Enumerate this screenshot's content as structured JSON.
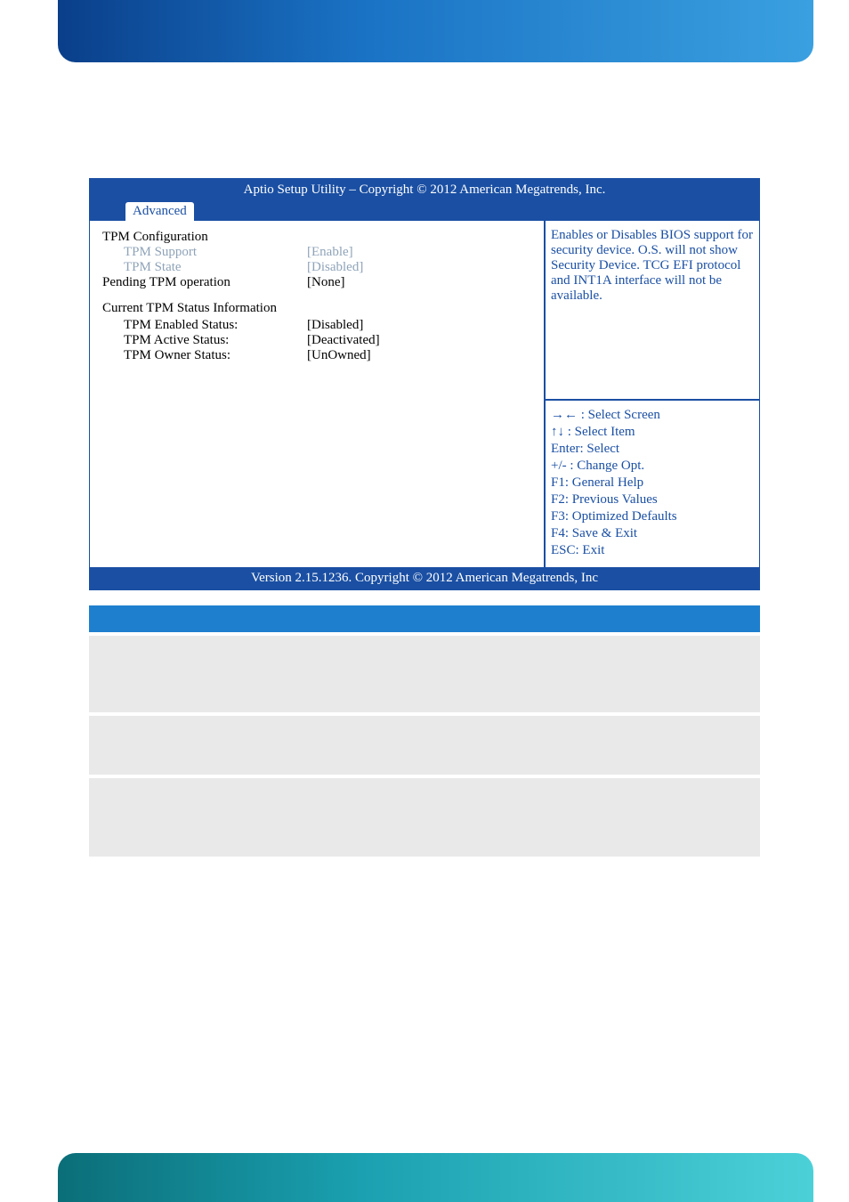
{
  "bios": {
    "title": "Aptio Setup Utility  –  Copyright © 2012 American Megatrends, Inc.",
    "active_tab": "Advanced",
    "footer": "Version 2.15.1236. Copyright © 2012 American Megatrends, Inc",
    "section_config_title": "TPM Configuration",
    "settings": [
      {
        "label": "TPM Support",
        "value": "[Enable]",
        "highlight": true
      },
      {
        "label": "TPM State",
        "value": "[Disabled]",
        "highlight": true
      },
      {
        "label": "Pending TPM operation",
        "value": "[None]",
        "highlight": false
      }
    ],
    "status_title": "Current TPM Status Information",
    "status": [
      {
        "label": "TPM Enabled Status:",
        "value": "[Disabled]"
      },
      {
        "label": "TPM Active Status:",
        "value": "[Deactivated]"
      },
      {
        "label": "TPM Owner Status:",
        "value": "[UnOwned]"
      }
    ],
    "help_text": "Enables or Disables BIOS support for security device. O.S. will not show Security Device. TCG EFI protocol and INT1A interface will not be available.",
    "keys": [
      "→← : Select Screen",
      "↑↓ : Select Item",
      "Enter: Select",
      "+/- : Change Opt.",
      "F1: General Help",
      "F2: Previous Values",
      "F3: Optimized Defaults",
      "F4: Save & Exit",
      "ESC: Exit"
    ]
  },
  "table": {
    "headers": [
      "",
      "",
      ""
    ],
    "rows": [
      [
        "",
        "",
        ""
      ],
      [
        "",
        "",
        ""
      ],
      [
        "",
        "",
        ""
      ]
    ]
  }
}
